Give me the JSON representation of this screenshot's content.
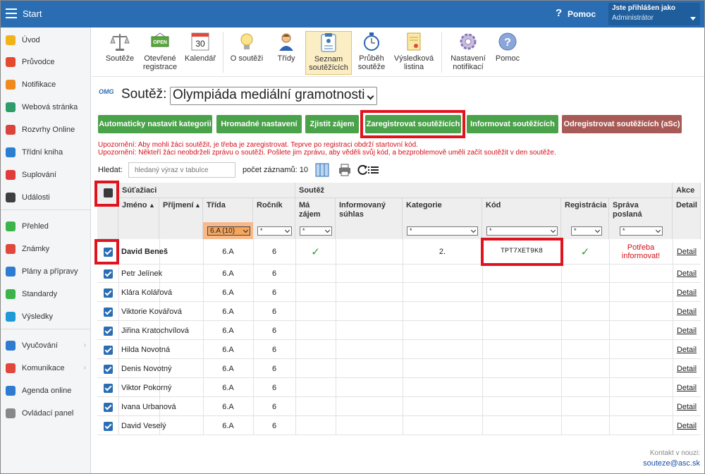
{
  "topbar": {
    "start_label": "Start",
    "help_icon": "?",
    "help_label": "Pomoc",
    "user_line1": "Jste přihlášen jako",
    "user_line2": "Administrátor"
  },
  "sidebar": {
    "items": [
      {
        "label": "Úvod",
        "icon": "star-icon",
        "color": "#f2b31a"
      },
      {
        "label": "Průvodce",
        "icon": "wand-icon",
        "color": "#e64a2e"
      },
      {
        "label": "Notifikace",
        "icon": "mail-icon",
        "color": "#f08a1d"
      },
      {
        "label": "Webová stránka",
        "icon": "home-icon",
        "color": "#2f9d6a"
      },
      {
        "label": "Rozvrhy Online",
        "icon": "grid-icon",
        "color": "#d9453b"
      },
      {
        "label": "Třídní kniha",
        "icon": "book-icon",
        "color": "#2a7fd0"
      },
      {
        "label": "Suplování",
        "icon": "user-circle-icon",
        "color": "#e23b3b"
      },
      {
        "label": "Události",
        "icon": "calendar-icon",
        "color": "#3f3f3f"
      },
      {
        "label": "Přehled",
        "icon": "check-circle-icon",
        "color": "#3bb54a"
      },
      {
        "label": "Známky",
        "icon": "grade-icon",
        "color": "#e2473b"
      },
      {
        "label": "Plány a přípravy",
        "icon": "briefcase-icon",
        "color": "#2f7bd1"
      },
      {
        "label": "Standardy",
        "icon": "shield-icon",
        "color": "#3bb54a"
      },
      {
        "label": "Výsledky",
        "icon": "bar-chart-icon",
        "color": "#1e9bd7"
      },
      {
        "label": "Vyučování",
        "icon": "folder-icon",
        "color": "#2f7bd1"
      },
      {
        "label": "Komunikace",
        "icon": "chat-icon",
        "color": "#e2473b"
      },
      {
        "label": "Agenda online",
        "icon": "pen-icon",
        "color": "#2f7bd1"
      },
      {
        "label": "Ovládací panel",
        "icon": "gear-icon",
        "color": "#888888"
      }
    ]
  },
  "toolbar": {
    "items": [
      {
        "l1": "Soutěže",
        "l2": "",
        "icon": "scales-icon"
      },
      {
        "l1": "Otevřené",
        "l2": "registrace",
        "icon": "open-sign-icon",
        "badge": "OPEN"
      },
      {
        "l1": "Kalendář",
        "l2": "",
        "icon": "calendar-30-icon",
        "badge": "30"
      },
      {
        "l1": "O soutěži",
        "l2": "",
        "icon": "lightbulb-icon"
      },
      {
        "l1": "Třídy",
        "l2": "",
        "icon": "student-icon"
      },
      {
        "l1": "Seznam",
        "l2": "soutěžících",
        "icon": "clipboard-list-icon"
      },
      {
        "l1": "Průběh",
        "l2": "soutěže",
        "icon": "stopwatch-icon"
      },
      {
        "l1": "Výsledková",
        "l2": "listina",
        "icon": "certificate-icon"
      },
      {
        "l1": "Nastavení",
        "l2": "notifikací",
        "icon": "settings-icon"
      },
      {
        "l1": "Pomoc",
        "l2": "",
        "icon": "help-circle-icon"
      }
    ]
  },
  "page": {
    "logo_text": "OMG",
    "title_label": "Soutěž:",
    "competition": "Olympiáda mediální gramotnosti"
  },
  "actions": {
    "auto_category": "Automaticky nastavit kategorii",
    "bulk_setting": "Hromadné nastavení",
    "check_interest": "Zjistit zájem",
    "register": "Zaregistrovat soutěžících",
    "inform": "Informovat soutěžících",
    "unregister": "Odregistrovat soutěžících (aSc)"
  },
  "warnings": {
    "w1": "Upozornění: Aby mohli žáci soutěžit, je třeba je zaregistrovat. Teprve po registraci obdrží startovní kód.",
    "w2": "Upozornění: Někteří žáci neobdrželi zprávu o soutěži. Pošlete jim zprávu, aby věděli svůj kód, a bezproblemově uměli začít soutěžit v den soutěže."
  },
  "search": {
    "label": "Hledat:",
    "placeholder": "hledaný výraz v tabulce",
    "count_label": "počet záznamů: 10"
  },
  "table": {
    "group_students": "Súťažiaci",
    "group_competition": "Soutěž",
    "group_action": "Akce",
    "col_first": "Jméno",
    "col_last": "Příjmení",
    "col_class": "Třída",
    "col_year": "Ročník",
    "col_interest_1": "Má",
    "col_interest_2": "zájem",
    "col_consent_1": "Informovaný",
    "col_consent_2": "súhlas",
    "col_category": "Kategorie",
    "col_code": "Kód",
    "col_registration": "Registrácia",
    "col_message_1": "Správa",
    "col_message_2": "poslaná",
    "col_detail": "Detail",
    "filter_class": "6.A (10)",
    "filter_any": "*",
    "sort_icon": "▲",
    "rows": [
      {
        "name": "David Beneš",
        "class": "6.A",
        "year": "6",
        "interest": "✓",
        "category": "2.",
        "code": "TPT7XET9K8",
        "registered": "✓",
        "message_1": "Potřeba",
        "message_2": "informovat!",
        "detail": "Detail"
      },
      {
        "name": "Petr Jelínek",
        "class": "6.A",
        "year": "6",
        "detail": "Detail"
      },
      {
        "name": "Klára Kolářová",
        "class": "6.A",
        "year": "6",
        "detail": "Detail"
      },
      {
        "name": "Viktorie Kovářová",
        "class": "6.A",
        "year": "6",
        "detail": "Detail"
      },
      {
        "name": "Jiřina Kratochvílová",
        "class": "6.A",
        "year": "6",
        "detail": "Detail"
      },
      {
        "name": "Hilda Novotná",
        "class": "6.A",
        "year": "6",
        "detail": "Detail"
      },
      {
        "name": "Denis Novotný",
        "class": "6.A",
        "year": "6",
        "detail": "Detail"
      },
      {
        "name": "Viktor Pokorný",
        "class": "6.A",
        "year": "6",
        "detail": "Detail"
      },
      {
        "name": "Ivana Urbanová",
        "class": "6.A",
        "year": "6",
        "detail": "Detail"
      },
      {
        "name": "David Veselý",
        "class": "6.A",
        "year": "6",
        "detail": "Detail"
      }
    ]
  },
  "footer": {
    "contact_label": "Kontakt v nouzi:",
    "email": "souteze@asc.sk"
  },
  "colors": {
    "topbar": "#2a6db3",
    "green_button": "#4aa24a",
    "red_button": "#a85b56",
    "highlight": "#e0141e",
    "warning_text": "#d4101a"
  }
}
